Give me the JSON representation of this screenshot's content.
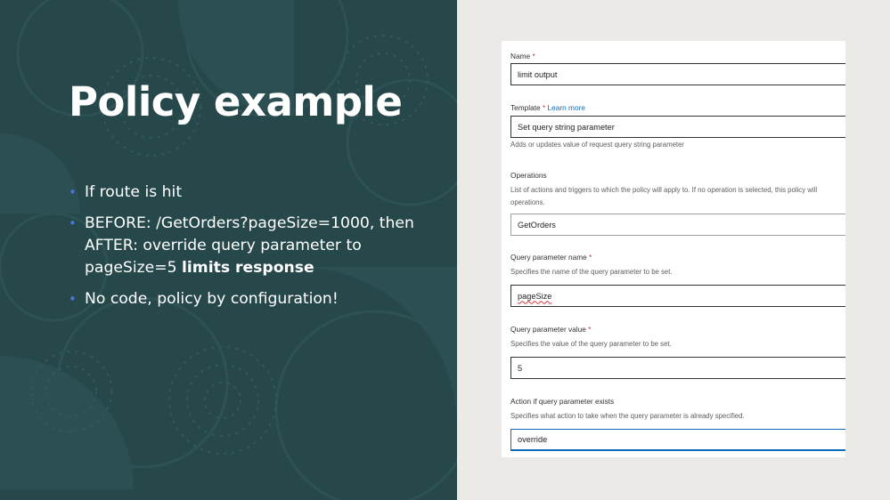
{
  "slide": {
    "title": "Policy example",
    "bullets": [
      {
        "lines": [
          "If route is hit"
        ]
      },
      {
        "lines": [
          "BEFORE: /GetOrders?pageSize=1000, then",
          "AFTER: override query parameter to"
        ],
        "last_line": "pageSize=5 ",
        "bold": "limits response"
      },
      {
        "lines": [
          "No code, policy by configuration!"
        ]
      }
    ],
    "accent_color": "#27484b",
    "bullet_color": "#4a77d6"
  },
  "form": {
    "name": {
      "label": "Name",
      "required": "*",
      "value": "limit output"
    },
    "template": {
      "label": "Template",
      "required": "*",
      "link": "Learn more",
      "value": "Set query string parameter",
      "description": "Adds or updates value of request query string parameter"
    },
    "operations": {
      "label": "Operations",
      "description_line1": "List of actions and triggers to which the policy will apply to. If no operation is selected, this policy will",
      "description_line2": "operations.",
      "value": "GetOrders"
    },
    "query_name": {
      "label": "Query parameter name",
      "required": "*",
      "description": "Specifies the name of the query parameter to be set.",
      "value": "pageSize"
    },
    "query_value": {
      "label": "Query parameter value",
      "required": "*",
      "description": "Specifies the value of the query parameter to be set.",
      "value": "5"
    },
    "action": {
      "label": "Action if query parameter exists",
      "description": "Specifies what action to take when the query parameter is already specified.",
      "value": "override"
    }
  }
}
